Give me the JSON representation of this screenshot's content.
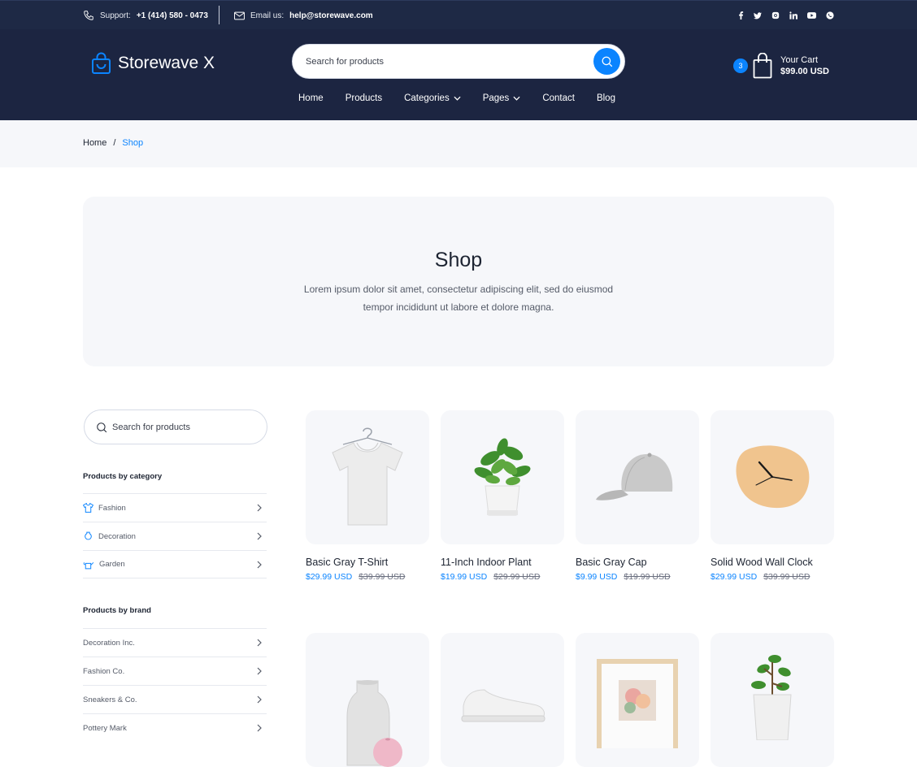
{
  "topbar": {
    "support_label": "Support:",
    "support_phone": "+1 (414) 580 - 0473",
    "email_label": "Email us:",
    "email": "help@storewave.com",
    "social": [
      "f",
      "t",
      "ig",
      "in",
      "yt",
      "wa"
    ]
  },
  "header": {
    "brand": "Storewave X",
    "search_placeholder": "Search for products",
    "cart_count": "3",
    "cart_label": "Your Cart",
    "cart_total": "$99.00 USD"
  },
  "nav": [
    {
      "label": "Home",
      "dropdown": false
    },
    {
      "label": "Products",
      "dropdown": false
    },
    {
      "label": "Categories",
      "dropdown": true
    },
    {
      "label": "Pages",
      "dropdown": true
    },
    {
      "label": "Contact",
      "dropdown": false
    },
    {
      "label": "Blog",
      "dropdown": false
    }
  ],
  "breadcrumb": {
    "home": "Home",
    "separator": "/",
    "current": "Shop"
  },
  "hero": {
    "title": "Shop",
    "description": "Lorem ipsum dolor sit amet, consectetur adipiscing elit, sed do eiusmod tempor incididunt ut labore et dolore magna."
  },
  "sidebar": {
    "search_placeholder": "Search for products",
    "category_heading": "Products by category",
    "categories": [
      {
        "label": "Fashion",
        "icon": "tshirt-icon"
      },
      {
        "label": "Decoration",
        "icon": "vase-icon"
      },
      {
        "label": "Garden",
        "icon": "watering-can-icon"
      }
    ],
    "brand_heading": "Products by brand",
    "brands": [
      "Decoration Inc.",
      "Fashion Co.",
      "Sneakers & Co.",
      "Pottery Mark"
    ]
  },
  "products": [
    {
      "name": "Basic Gray T-Shirt",
      "price": "$29.99 USD",
      "old_price": "$39.99 USD",
      "image": "tshirt"
    },
    {
      "name": "11-Inch Indoor Plant",
      "price": "$19.99 USD",
      "old_price": "$29.99 USD",
      "image": "plant"
    },
    {
      "name": "Basic Gray Cap",
      "price": "$9.99 USD",
      "old_price": "$19.99 USD",
      "image": "cap"
    },
    {
      "name": "Solid Wood Wall Clock",
      "price": "$29.99 USD",
      "old_price": "$39.99 USD",
      "image": "clock"
    },
    {
      "name": "",
      "price": "",
      "old_price": "",
      "image": "vase"
    },
    {
      "name": "",
      "price": "",
      "old_price": "",
      "image": "sneaker"
    },
    {
      "name": "",
      "price": "",
      "old_price": "",
      "image": "frame"
    },
    {
      "name": "",
      "price": "",
      "old_price": "",
      "image": "bonsai"
    }
  ],
  "colors": {
    "accent": "#0b84ff",
    "header_bg": "#1c2541",
    "topbar_bg": "#1e2945",
    "panel_bg": "#f6f7fa"
  }
}
